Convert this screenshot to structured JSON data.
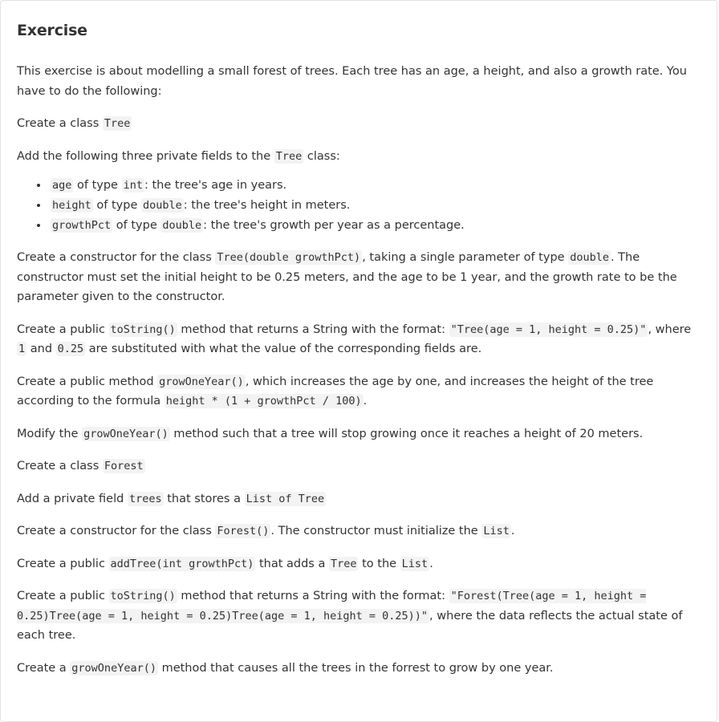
{
  "title": "Exercise",
  "intro": "This exercise is about modelling a small forest of trees. Each tree has an age, a height, and also a growth rate. You have to do the following:",
  "step1": {
    "text": "Create a class ",
    "code": "Tree"
  },
  "step2": {
    "pre": "Add the following three private fields to the ",
    "code": "Tree",
    "post": " class:"
  },
  "fields": [
    {
      "name": "age",
      "type_pre": " of type ",
      "type": "int",
      "desc": ": the tree's age in years."
    },
    {
      "name": "height",
      "type_pre": " of type ",
      "type": "double",
      "desc": ": the tree's height in meters."
    },
    {
      "name": "growthPct",
      "type_pre": " of type ",
      "type": "double",
      "desc": ": the tree's growth per year as a percentage."
    }
  ],
  "step3": {
    "pre": "Create a constructor for the class ",
    "code1": "Tree(double growthPct)",
    "mid": ", taking a single parameter of type ",
    "code2": "double",
    "post": ". The constructor must set the initial height to be 0.25 meters, and the age to be 1 year, and the growth rate to be the parameter given to the constructor."
  },
  "step4": {
    "pre": "Create a public ",
    "code1": "toString()",
    "mid1": " method that returns a String with the format: ",
    "code2": "\"Tree(age = 1, height = 0.25)\"",
    "mid2": ", where ",
    "code3": "1",
    "mid3": " and ",
    "code4": "0.25",
    "post": " are substituted with what the value of the corresponding fields are."
  },
  "step5": {
    "pre": "Create a public method ",
    "code1": "growOneYear()",
    "mid": ", which increases the age by one, and increases the height of the tree according to the formula ",
    "code2": "height * (1 + growthPct / 100)",
    "post": "."
  },
  "step6": {
    "pre": "Modify the ",
    "code": "growOneYear()",
    "post": " method such that a tree will stop growing once it reaches a height of 20 meters."
  },
  "step7": {
    "text": "Create a class ",
    "code": "Forest"
  },
  "step8": {
    "pre": "Add a private field ",
    "code1": "trees",
    "mid": " that stores a ",
    "code2": "List of Tree"
  },
  "step9": {
    "pre": "Create a constructor for the class ",
    "code1": "Forest()",
    "mid": ". The constructor must initialize the ",
    "code2": "List",
    "post": "."
  },
  "step10": {
    "pre": "Create a public ",
    "code1": "addTree(int growthPct)",
    "mid1": " that adds a ",
    "code2": "Tree",
    "mid2": " to the ",
    "code3": "List",
    "post": "."
  },
  "step11": {
    "pre": "Create a public ",
    "code1": "toString()",
    "mid": " method that returns a String with the format: ",
    "code2": "\"Forest(Tree(age = 1, height = 0.25)Tree(age = 1, height = 0.25)Tree(age = 1, height = 0.25))\"",
    "post": ", where the data reflects the actual state of each tree."
  },
  "step12": {
    "pre": "Create a ",
    "code": "growOneYear()",
    "post": " method that causes all the trees in the forrest to grow by one year."
  }
}
